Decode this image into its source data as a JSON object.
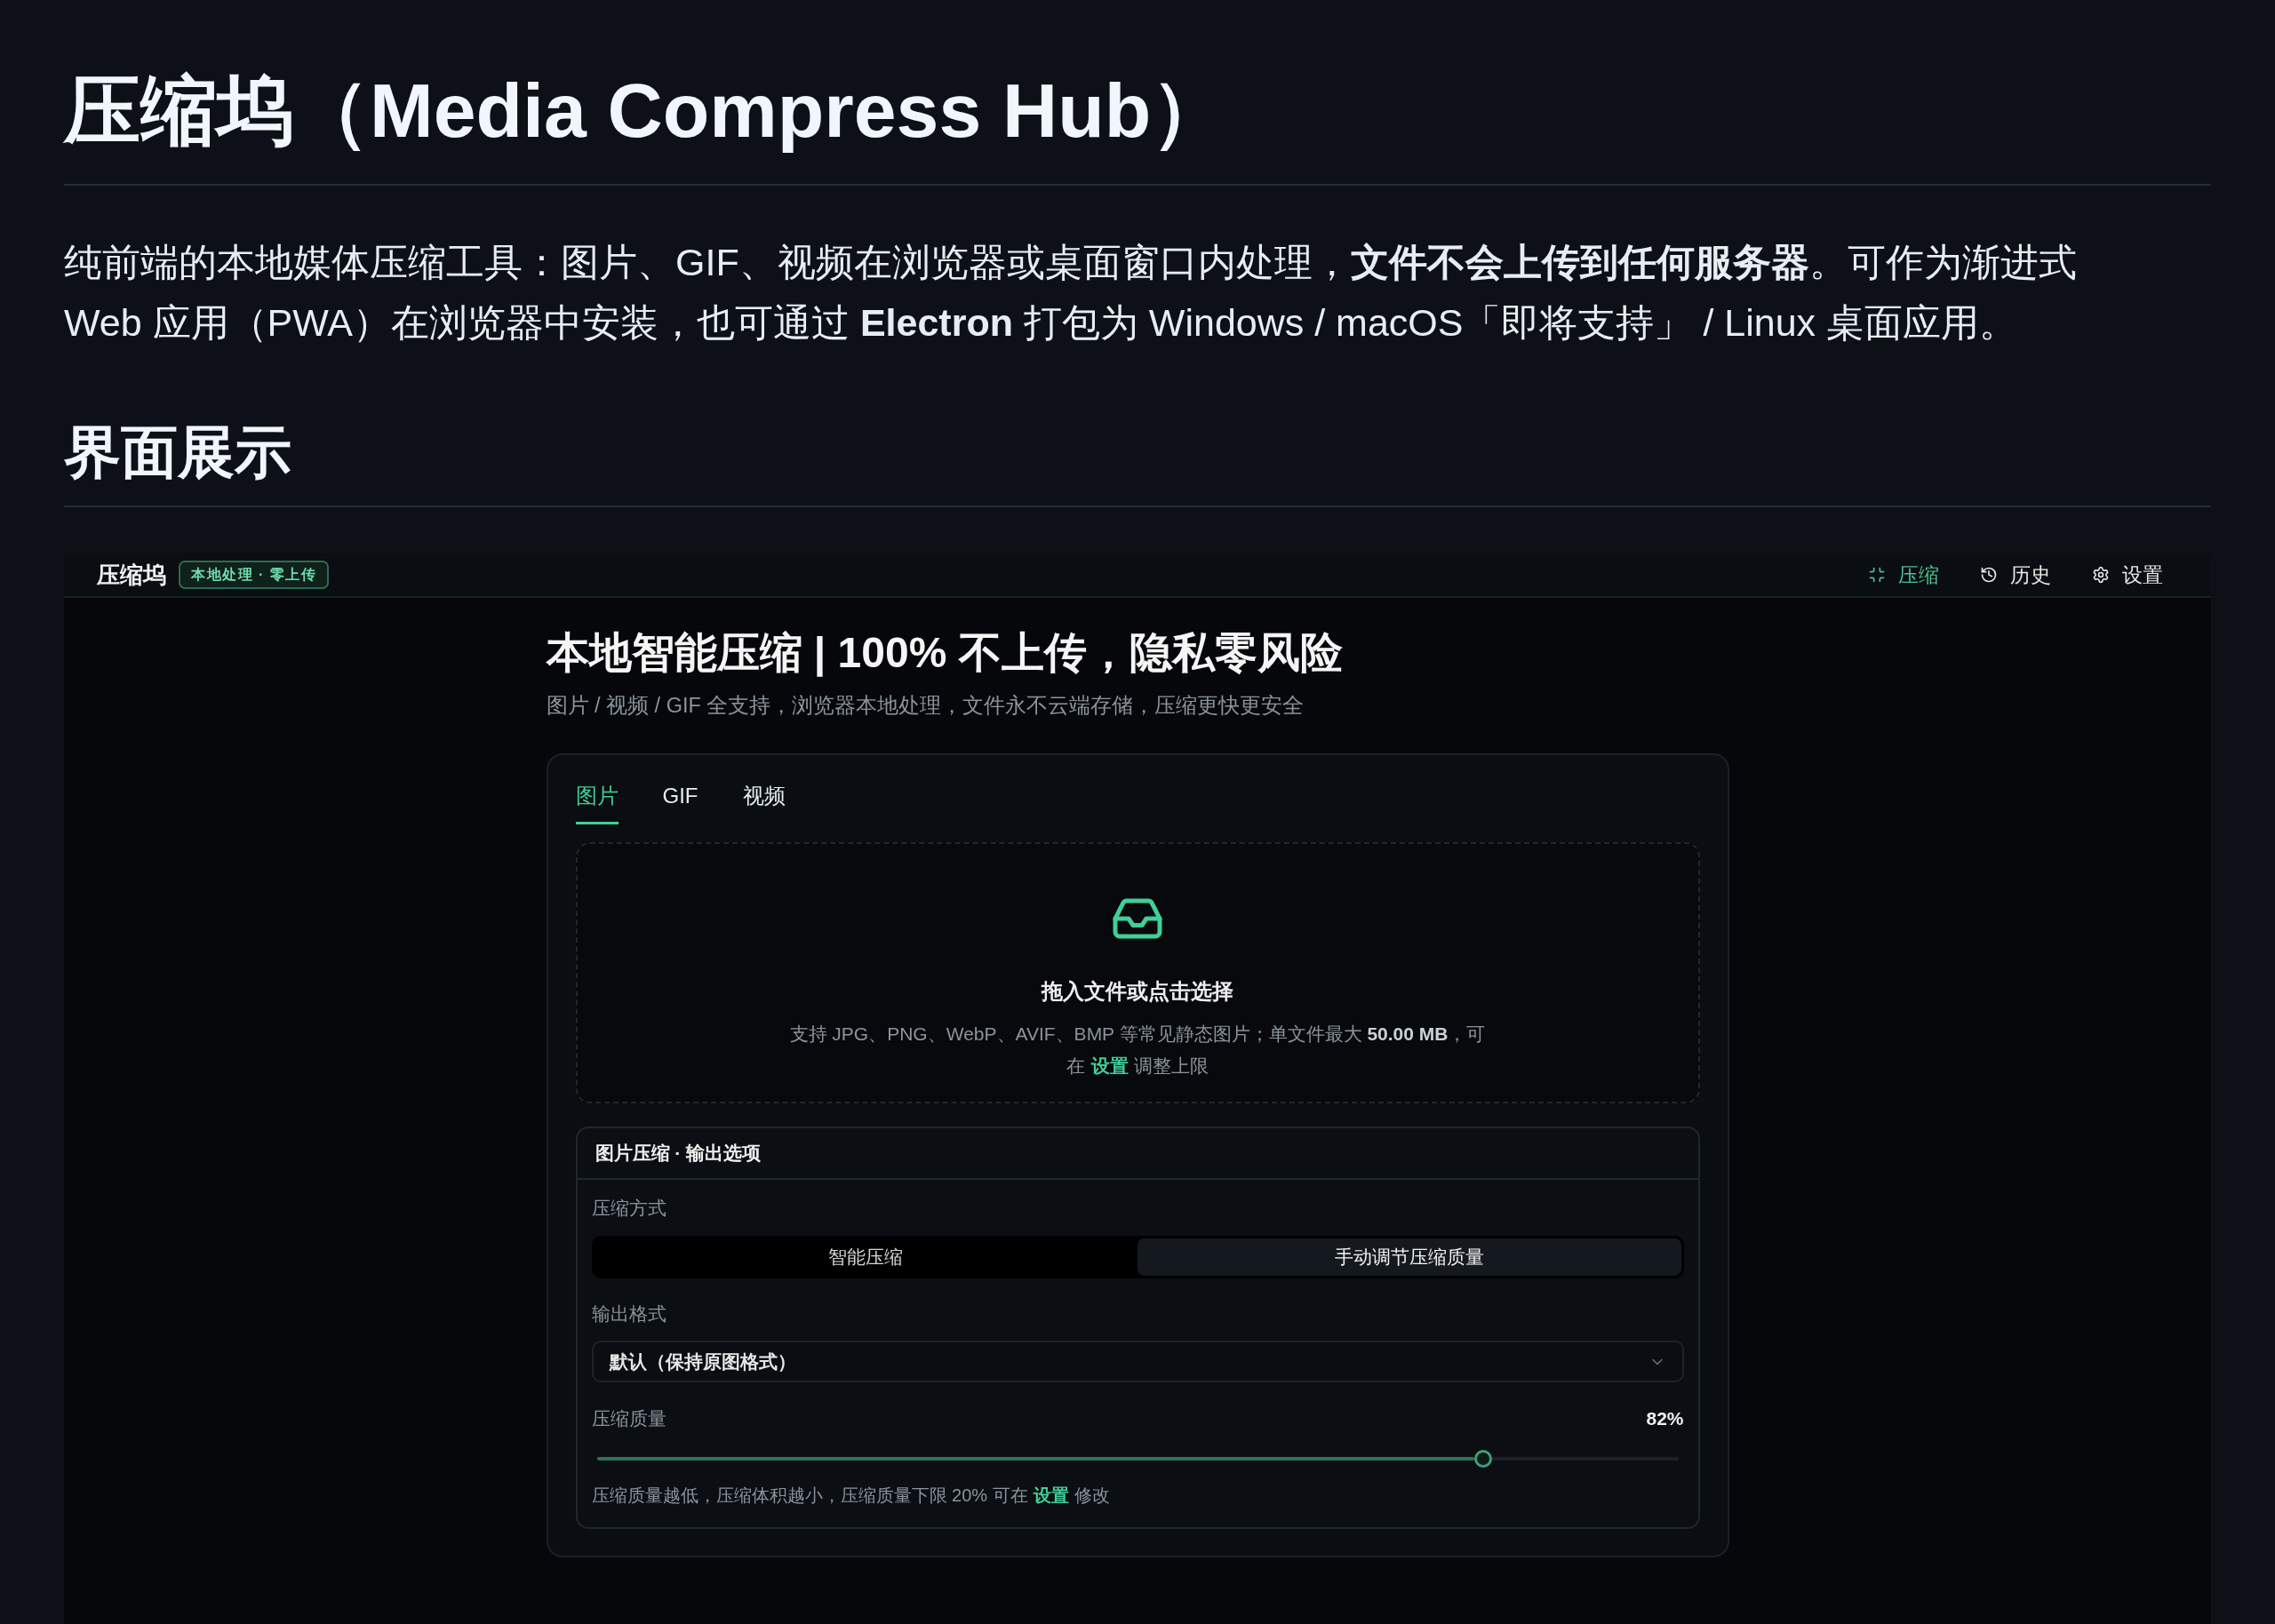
{
  "readme": {
    "title": "压缩坞（Media Compress Hub）",
    "intro": "纯前端的本地媒体压缩工具：图片、GIF、视频在浏览器或桌面窗口内处理，**文件不会上传到任何服务器**。可作为渐进式 Web 应用（PWA）在浏览器中安装，也可通过 **Electron** 打包为 Windows / macOS「即将支持」 / Linux 桌面应用。",
    "section_heading": "界面展示"
  },
  "screenshot": {
    "app_bar": {
      "brand": "压缩坞",
      "badge": "本地处理 · 零上传",
      "nav": [
        {
          "kind": "compress",
          "label": "压缩",
          "selected": true
        },
        {
          "kind": "history",
          "label": "历史",
          "selected": false
        },
        {
          "kind": "settings",
          "label": "设置",
          "selected": false
        }
      ]
    },
    "hero": {
      "title": "本地智能压缩 | 100% 不上传，隐私零风险",
      "subtitle": "图片 / 视频 / GIF 全支持，浏览器本地处理，文件永不云端存储，压缩更快更安全"
    },
    "tabs": [
      {
        "label": "图片",
        "selected": true
      },
      {
        "label": "GIF",
        "selected": false
      },
      {
        "label": "视频",
        "selected": false
      }
    ],
    "dropzone": {
      "title": "拖入文件或点击选择",
      "hint": {
        "text": "支持 JPG、PNG、WebP、AVIF、BMP 等常见静态图片；单文件最大 **50.00 MB**，可在",
        "link": "设置",
        "after": "调整上限"
      }
    },
    "options": {
      "title": "图片压缩 · 输出选项",
      "mode_label": "压缩方式",
      "modes": [
        {
          "label": "智能压缩",
          "selected": false
        },
        {
          "label": "手动调节压缩质量",
          "selected": true
        }
      ],
      "format_label": "输出格式",
      "format_value": "默认（保持原图格式）",
      "quality_label": "压缩质量",
      "quality_reading": "82%",
      "quality": {
        "level": 0.82
      },
      "hint": {
        "text": "压缩质量越低，压缩体积越小，压缩质量下限 20% 可在",
        "link": "设置",
        "after": "修改"
      }
    }
  }
}
